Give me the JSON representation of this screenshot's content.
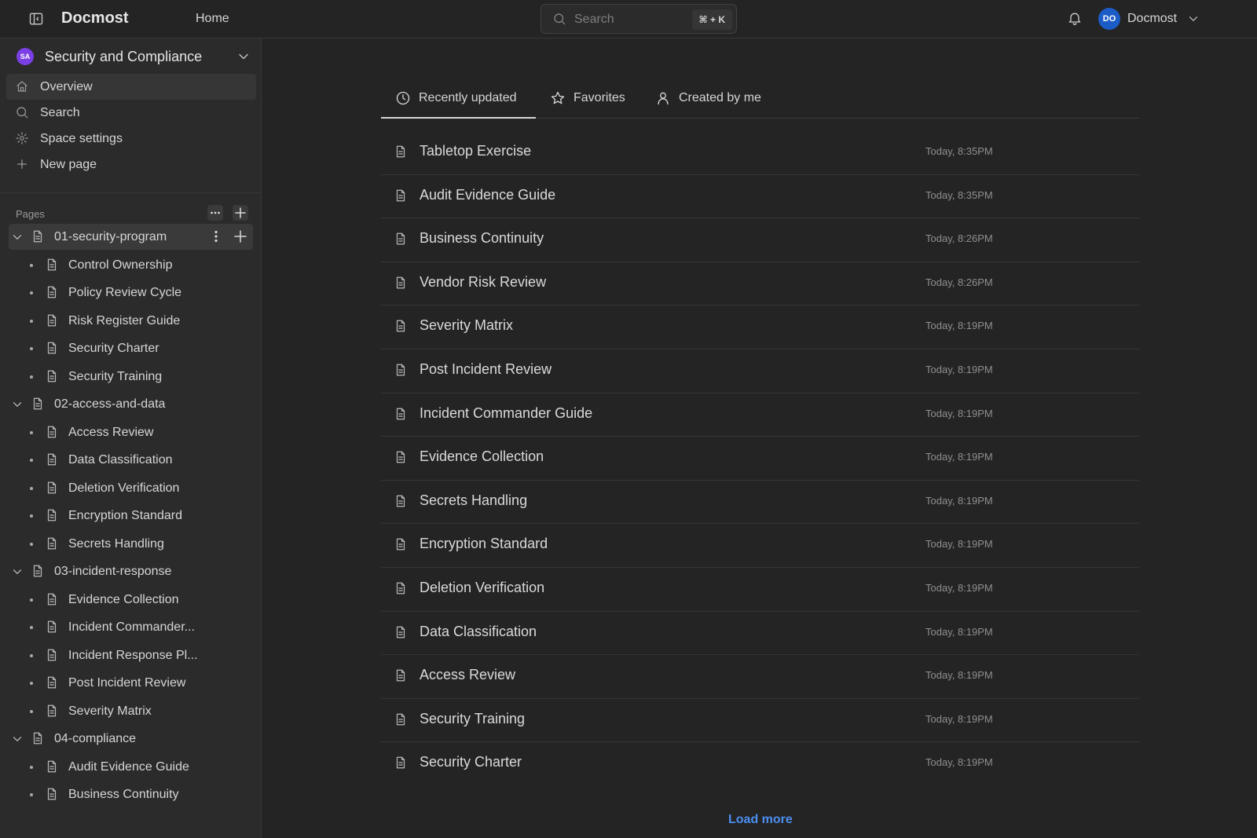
{
  "header": {
    "brand": "Docmost",
    "home": "Home",
    "search": {
      "placeholder": "Search",
      "shortcut": "⌘ + K"
    },
    "user": {
      "initials": "DO",
      "name": "Docmost"
    }
  },
  "sidebar": {
    "space": {
      "initials": "SA",
      "name": "Security and Compliance"
    },
    "nav": [
      {
        "label": "Overview",
        "icon": "home-icon"
      },
      {
        "label": "Search",
        "icon": "search-icon"
      },
      {
        "label": "Space settings",
        "icon": "gear-icon"
      },
      {
        "label": "New page",
        "icon": "plus-icon"
      }
    ],
    "pages_label": "Pages",
    "tree": [
      {
        "label": "01-security-program",
        "level": 0
      },
      {
        "label": "Control Ownership",
        "level": 1
      },
      {
        "label": "Policy Review Cycle",
        "level": 1
      },
      {
        "label": "Risk Register Guide",
        "level": 1
      },
      {
        "label": "Security Charter",
        "level": 1
      },
      {
        "label": "Security Training",
        "level": 1
      },
      {
        "label": "02-access-and-data",
        "level": 0
      },
      {
        "label": "Access Review",
        "level": 1
      },
      {
        "label": "Data Classification",
        "level": 1
      },
      {
        "label": "Deletion Verification",
        "level": 1
      },
      {
        "label": "Encryption Standard",
        "level": 1
      },
      {
        "label": "Secrets Handling",
        "level": 1
      },
      {
        "label": "03-incident-response",
        "level": 0
      },
      {
        "label": "Evidence Collection",
        "level": 1
      },
      {
        "label": "Incident Commander...",
        "level": 1
      },
      {
        "label": "Incident Response Pl...",
        "level": 1
      },
      {
        "label": "Post Incident Review",
        "level": 1
      },
      {
        "label": "Severity Matrix",
        "level": 1
      },
      {
        "label": "04-compliance",
        "level": 0
      },
      {
        "label": "Audit Evidence Guide",
        "level": 1
      },
      {
        "label": "Business Continuity",
        "level": 1
      }
    ]
  },
  "main": {
    "tabs": [
      {
        "label": "Recently updated",
        "icon": "clock-icon"
      },
      {
        "label": "Favorites",
        "icon": "star-icon"
      },
      {
        "label": "Created by me",
        "icon": "user-icon"
      }
    ],
    "pages": [
      {
        "title": "Tabletop Exercise",
        "time": "Today, 8:35PM"
      },
      {
        "title": "Audit Evidence Guide",
        "time": "Today, 8:35PM"
      },
      {
        "title": "Business Continuity",
        "time": "Today, 8:26PM"
      },
      {
        "title": "Vendor Risk Review",
        "time": "Today, 8:26PM"
      },
      {
        "title": "Severity Matrix",
        "time": "Today, 8:19PM"
      },
      {
        "title": "Post Incident Review",
        "time": "Today, 8:19PM"
      },
      {
        "title": "Incident Commander Guide",
        "time": "Today, 8:19PM"
      },
      {
        "title": "Evidence Collection",
        "time": "Today, 8:19PM"
      },
      {
        "title": "Secrets Handling",
        "time": "Today, 8:19PM"
      },
      {
        "title": "Encryption Standard",
        "time": "Today, 8:19PM"
      },
      {
        "title": "Deletion Verification",
        "time": "Today, 8:19PM"
      },
      {
        "title": "Data Classification",
        "time": "Today, 8:19PM"
      },
      {
        "title": "Access Review",
        "time": "Today, 8:19PM"
      },
      {
        "title": "Security Training",
        "time": "Today, 8:19PM"
      },
      {
        "title": "Security Charter",
        "time": "Today, 8:19PM"
      }
    ],
    "load_more": "Load more"
  }
}
